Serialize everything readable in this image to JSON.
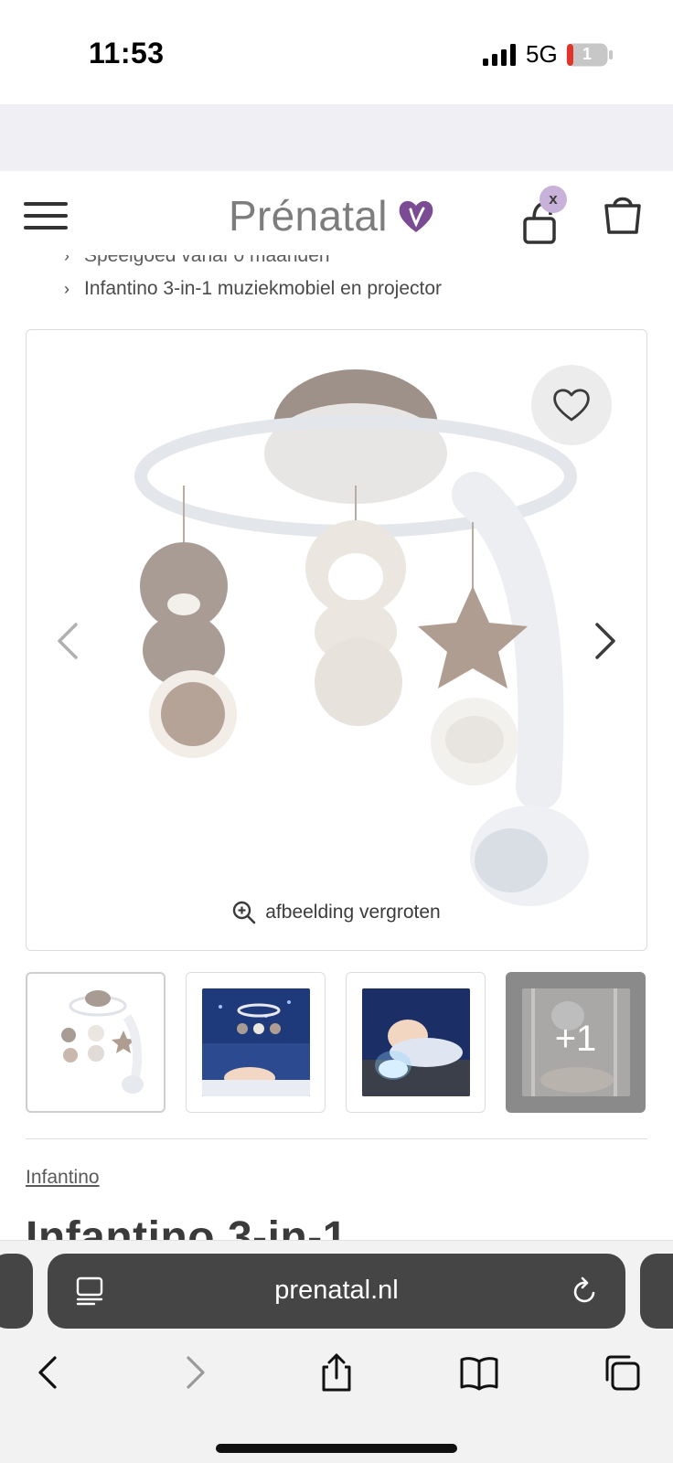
{
  "status_bar": {
    "time": "11:53",
    "network": "5G",
    "battery": "1"
  },
  "header": {
    "logo_text": "Prénatal",
    "account_badge": "x",
    "icons": [
      "menu-icon",
      "heart-logo-icon",
      "account-icon",
      "cart-icon"
    ]
  },
  "bullets": [
    {
      "label": "Speelgoed vanaf 0 maanden"
    },
    {
      "label": "Infantino 3-in-1 muziekmobiel en projector"
    }
  ],
  "gallery": {
    "zoom_label": "afbeelding vergroten",
    "thumbnails": [
      {
        "label": "mobile"
      },
      {
        "label": "nursery-projection"
      },
      {
        "label": "night-light"
      },
      {
        "label": "crib",
        "more": "+1"
      }
    ]
  },
  "product": {
    "brand": "Infantino",
    "title": "Infantino 3-in-1"
  },
  "browser": {
    "url": "prenatal.nl",
    "toolbar": [
      "back-icon",
      "forward-icon",
      "share-icon",
      "bookmarks-icon",
      "tabs-icon"
    ]
  },
  "colors": {
    "accent_purple": "#7b4b94",
    "badge_purple": "#c9b2d9",
    "logo_grey": "#7d7d7d",
    "url_bar": "#454545"
  }
}
